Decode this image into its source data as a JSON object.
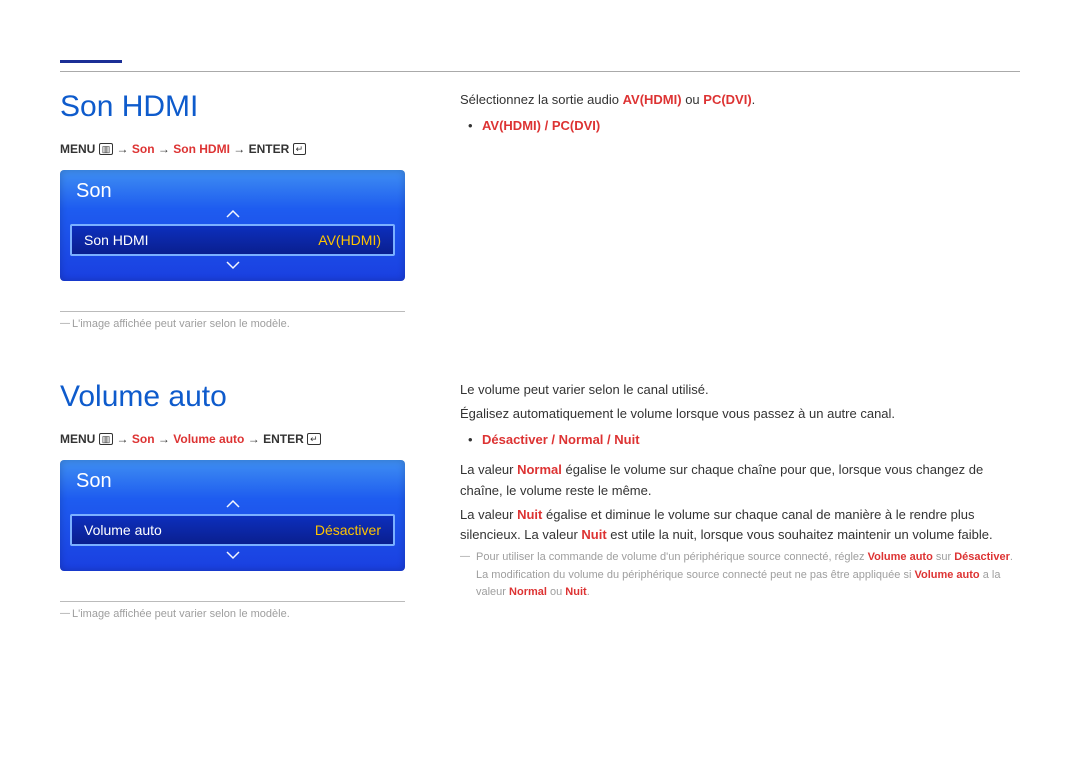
{
  "section1": {
    "title": "Son HDMI",
    "breadcrumb": {
      "menu": "MENU",
      "arrow": "→",
      "p1": "Son",
      "p2": "Son HDMI",
      "enter": "ENTER",
      "menu_icon": "▥",
      "enter_icon": "↵"
    },
    "osd": {
      "title": "Son",
      "row_label": "Son HDMI",
      "row_value": "AV(HDMI)"
    },
    "note": "L'image affichée peut varier selon le modèle.",
    "right": {
      "line1_a": "Sélectionnez la sortie audio ",
      "line1_b": "AV(HDMI)",
      "line1_c": " ou ",
      "line1_d": "PC(DVI)",
      "line1_e": ".",
      "opt_a": "AV(HDMI)",
      "opt_sep": " / ",
      "opt_b": "PC(DVI)"
    }
  },
  "section2": {
    "title": "Volume auto",
    "breadcrumb": {
      "menu": "MENU",
      "arrow": "→",
      "p1": "Son",
      "p2": "Volume auto",
      "enter": "ENTER",
      "menu_icon": "▥",
      "enter_icon": "↵"
    },
    "osd": {
      "title": "Son",
      "row_label": "Volume auto",
      "row_value": "Désactiver"
    },
    "note": "L'image affichée peut varier selon le modèle.",
    "right": {
      "p1": "Le volume peut varier selon le canal utilisé.",
      "p2": "Égalisez automatiquement le volume lorsque vous passez à un autre canal.",
      "opt_a": "Désactiver",
      "opt_sep1": " / ",
      "opt_b": "Normal",
      "opt_sep2": " / ",
      "opt_c": "Nuit",
      "p3_a": "La valeur ",
      "p3_b": "Normal",
      "p3_c": " égalise le volume sur chaque chaîne pour que, lorsque vous changez de chaîne, le volume reste le même.",
      "p4_a": "La valeur ",
      "p4_b": "Nuit",
      "p4_c": " égalise et diminue le volume sur chaque canal de manière à le rendre plus silencieux. La valeur ",
      "p4_d": "Nuit",
      "p4_e": " est utile la nuit, lorsque vous souhaitez maintenir un volume faible.",
      "fn_a": "Pour utiliser la commande de volume d'un périphérique source connecté, réglez ",
      "fn_b": "Volume auto",
      "fn_c": " sur ",
      "fn_d": "Désactiver",
      "fn_e": ". La modification du volume du périphérique source connecté peut ne pas être appliquée si ",
      "fn_f": "Volume auto",
      "fn_g": " a la valeur ",
      "fn_h": "Normal",
      "fn_i": " ou ",
      "fn_j": "Nuit",
      "fn_k": "."
    }
  }
}
